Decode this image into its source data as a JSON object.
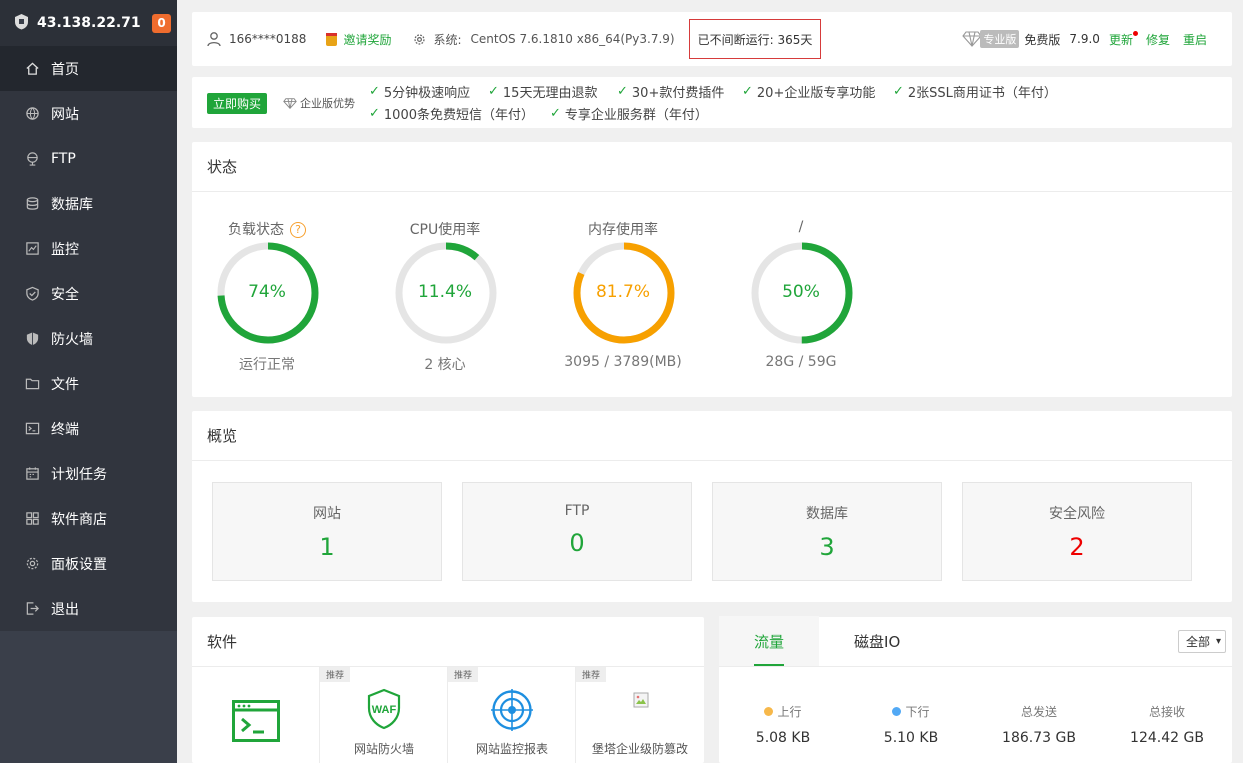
{
  "sidebar": {
    "ip": "43.138.22.71",
    "badge": "0",
    "items": [
      {
        "label": "首页",
        "icon": "home-icon"
      },
      {
        "label": "网站",
        "icon": "globe-icon"
      },
      {
        "label": "FTP",
        "icon": "ftp-icon"
      },
      {
        "label": "数据库",
        "icon": "database-icon"
      },
      {
        "label": "监控",
        "icon": "monitor-icon"
      },
      {
        "label": "安全",
        "icon": "shield-check-icon"
      },
      {
        "label": "防火墙",
        "icon": "firewall-shield-icon"
      },
      {
        "label": "文件",
        "icon": "folder-icon"
      },
      {
        "label": "终端",
        "icon": "terminal-icon"
      },
      {
        "label": "计划任务",
        "icon": "calendar-icon"
      },
      {
        "label": "软件商店",
        "icon": "grid-apps-icon"
      },
      {
        "label": "面板设置",
        "icon": "gear-icon"
      },
      {
        "label": "退出",
        "icon": "logout-icon"
      }
    ]
  },
  "topbar": {
    "user": "166****0188",
    "invite": "邀请奖励",
    "sys_label": "系统:",
    "sys_value": "CentOS 7.6.1810 x86_64(Py3.7.9)",
    "uptime": "已不间断运行: 365天",
    "pro": "专业版",
    "free": "免费版",
    "version": "7.9.0",
    "update": "更新",
    "repair": "修复",
    "restart": "重启"
  },
  "promo": {
    "buy": "立即购买",
    "enterprise": "企业版优势",
    "features": [
      "5分钟极速响应",
      "15天无理由退款",
      "30+款付费插件",
      "20+企业版专享功能",
      "2张SSL商用证书（年付）",
      "1000条免费短信（年付）",
      "专享企业服务群（年付）"
    ]
  },
  "status": {
    "title": "状态",
    "gauges": [
      {
        "title": "负载状态",
        "value": "74%",
        "fraction": 0.74,
        "sub": "运行正常",
        "color": "#20a53a"
      },
      {
        "title": "CPU使用率",
        "value": "11.4%",
        "fraction": 0.114,
        "sub": "2 核心",
        "color": "#20a53a"
      },
      {
        "title": "内存使用率",
        "value": "81.7%",
        "fraction": 0.817,
        "sub": "3095 / 3789(MB)",
        "color": "#f7a000"
      },
      {
        "title": "/",
        "value": "50%",
        "fraction": 0.5,
        "sub": "28G / 59G",
        "color": "#20a53a"
      }
    ]
  },
  "overview": {
    "title": "概览",
    "items": [
      {
        "label": "网站",
        "value": "1"
      },
      {
        "label": "FTP",
        "value": "0"
      },
      {
        "label": "数据库",
        "value": "3"
      },
      {
        "label": "安全风险",
        "value": "2"
      }
    ]
  },
  "software": {
    "title": "软件",
    "recommend": "推荐",
    "items": [
      {
        "name": ""
      },
      {
        "name": "网站防火墙"
      },
      {
        "name": "网站监控报表"
      },
      {
        "name": "堡塔企业级防篡改"
      }
    ]
  },
  "traffic": {
    "tabs": [
      "流量",
      "磁盘IO"
    ],
    "select": "全部",
    "stats": [
      {
        "label": "上行",
        "value": "5.08 KB",
        "dot": "#f7b84a"
      },
      {
        "label": "下行",
        "value": "5.10 KB",
        "dot": "#52a9f5"
      },
      {
        "label": "总发送",
        "value": "186.73 GB"
      },
      {
        "label": "总接收",
        "value": "124.42 GB"
      }
    ]
  },
  "colors": {
    "accent": "#20a53a",
    "warning": "#f7a000",
    "danger": "#ee0000",
    "sidebar": "#3a3f4a"
  }
}
